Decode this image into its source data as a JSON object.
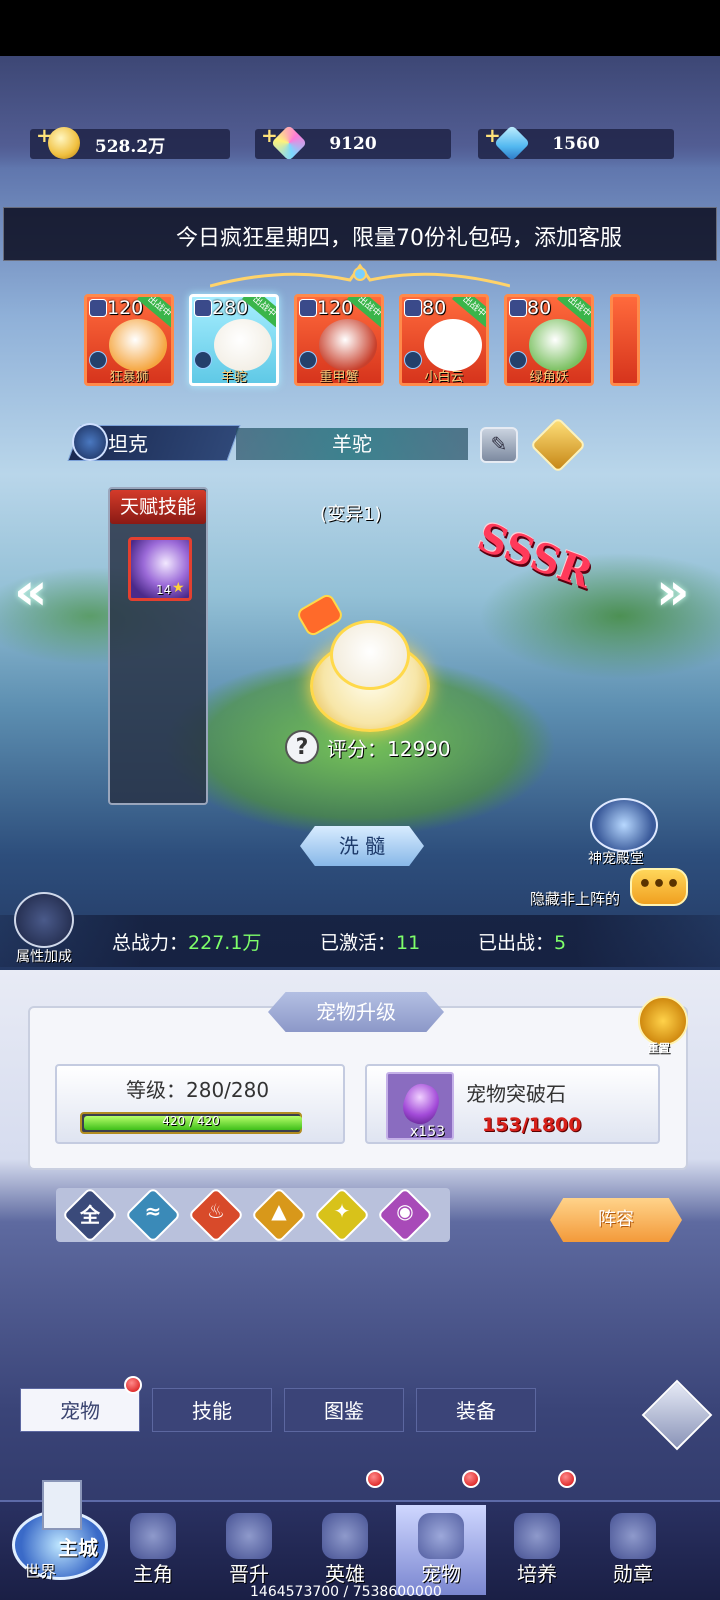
{
  "currencies": [
    {
      "icon": "gold-coin-icon",
      "value": "528.2万"
    },
    {
      "icon": "rainbow-crystal-icon",
      "value": "9120"
    },
    {
      "icon": "blue-diamond-icon",
      "value": "1560"
    }
  ],
  "marquee": "今日疯狂星期四，限量70份礼包码，添加客服",
  "pet_roster": [
    {
      "level": "120",
      "name": "狂暴狮",
      "active": false
    },
    {
      "level": "280",
      "name": "羊驼",
      "active": true
    },
    {
      "level": "120",
      "name": "重甲蟹",
      "active": false
    },
    {
      "level": "80",
      "name": "小白云",
      "active": false
    },
    {
      "level": "80",
      "name": "绿角妖",
      "active": false
    }
  ],
  "pet_status_tag": "出战中",
  "pet": {
    "role": "坦克",
    "name": "羊驼",
    "variant": "(变异1)",
    "rarity": "SSSR",
    "score_label": "评分：",
    "score": "12990"
  },
  "talent": {
    "title": "天赋技能",
    "level": "14"
  },
  "buttons": {
    "wash": "洗 髓",
    "reset": "重置",
    "lineup": "阵容",
    "attr": "属性加成"
  },
  "temple": {
    "label": "神宠殿堂"
  },
  "hide_label": "隐藏非上阵的",
  "stats": {
    "power_label": "总战力：",
    "power": "227.1万",
    "activated_label": "已激活：",
    "activated": "11",
    "deployed_label": "已出战：",
    "deployed": "5"
  },
  "upgrade": {
    "title": "宠物升级",
    "level_text": "等级：280/280",
    "exp_text": "420 / 420",
    "exp_fraction": 1.0,
    "stone_name": "宠物突破石",
    "stone_count": "x153",
    "stone_requirement": "153/1800"
  },
  "filters": [
    {
      "glyph": "全",
      "color": "#3a4a7a"
    },
    {
      "glyph": "≈",
      "color": "#3a8ab8"
    },
    {
      "glyph": "♨",
      "color": "#d84a2a"
    },
    {
      "glyph": "▲",
      "color": "#d8981a"
    },
    {
      "glyph": "✦",
      "color": "#d8c21a"
    },
    {
      "glyph": "◉",
      "color": "#a84ab8"
    }
  ],
  "subtabs": [
    {
      "label": "宠物",
      "active": true
    },
    {
      "label": "技能",
      "active": false
    },
    {
      "label": "图鉴",
      "active": false
    },
    {
      "label": "装备",
      "active": false
    }
  ],
  "main_city": {
    "main": "主城",
    "world": "世界"
  },
  "nav": [
    {
      "label": "主角",
      "dot": false
    },
    {
      "label": "晋升",
      "dot": false
    },
    {
      "label": "英雄",
      "dot": true
    },
    {
      "label": "宠物",
      "dot": true,
      "active": true
    },
    {
      "label": "培养",
      "dot": true
    },
    {
      "label": "勋章",
      "dot": false
    }
  ],
  "debug": "1464573700 / 7538600000"
}
